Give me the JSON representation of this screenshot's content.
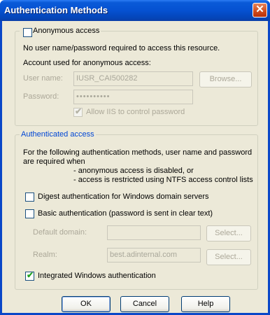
{
  "window": {
    "title": "Authentication Methods",
    "close_glyph": "✕"
  },
  "anonymous": {
    "checkbox_label": "Anonymous access",
    "checked": false,
    "description": "No user name/password required to access this resource.",
    "account_caption": "Account used for anonymous access:",
    "username_label": "User name:",
    "username_value": "IUSR_CAI500282",
    "browse_label": "Browse...",
    "password_label": "Password:",
    "password_value": "••••••••••",
    "allow_iis_label": "Allow IIS to control password",
    "allow_iis_checked": true
  },
  "authenticated": {
    "legend": "Authenticated access",
    "desc_line1": "For the following authentication methods, user name and password",
    "desc_line2": "are required when",
    "bullet1": "- anonymous access is disabled, or",
    "bullet2": "- access is restricted using NTFS access control lists",
    "digest_label": "Digest authentication for Windows domain servers",
    "digest_checked": false,
    "basic_label": "Basic authentication (password is sent in clear text)",
    "basic_checked": false,
    "default_domain_label": "Default domain:",
    "default_domain_value": "",
    "realm_label": "Realm:",
    "realm_value": "best.adinternal.com",
    "select_label": "Select...",
    "integrated_label": "Integrated Windows authentication",
    "integrated_checked": true
  },
  "buttons": {
    "ok": "OK",
    "cancel": "Cancel",
    "help": "Help"
  },
  "check_glyph": "✔"
}
